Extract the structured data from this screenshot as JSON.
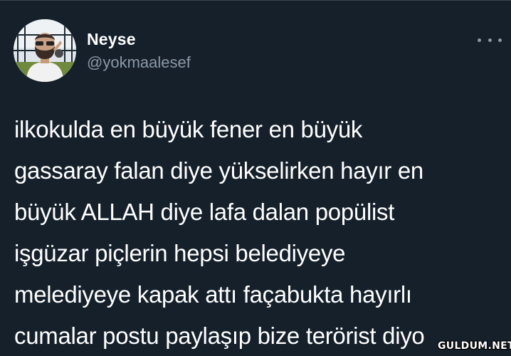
{
  "tweet": {
    "author": {
      "name": "Neyse",
      "handle": "@yokmaalesef"
    },
    "more_icon": "more-options-ellipsis",
    "text_lines": [
      "ilkokulda en büyük fener en büyük",
      "gassaray falan diye yükselirken hayır en",
      "büyük ALLAH diye lafa dalan popülist",
      "işgüzar piçlerin hepsi belediyeye",
      "melediyeye kapak attı façabukta hayırlı",
      "cumalar postu paylaşıp bize terörist diyo"
    ]
  },
  "watermark": "GULDUM.NET",
  "colors": {
    "background": "#15202b",
    "text_primary": "#ffffff",
    "text_secondary": "#8b98a5"
  }
}
